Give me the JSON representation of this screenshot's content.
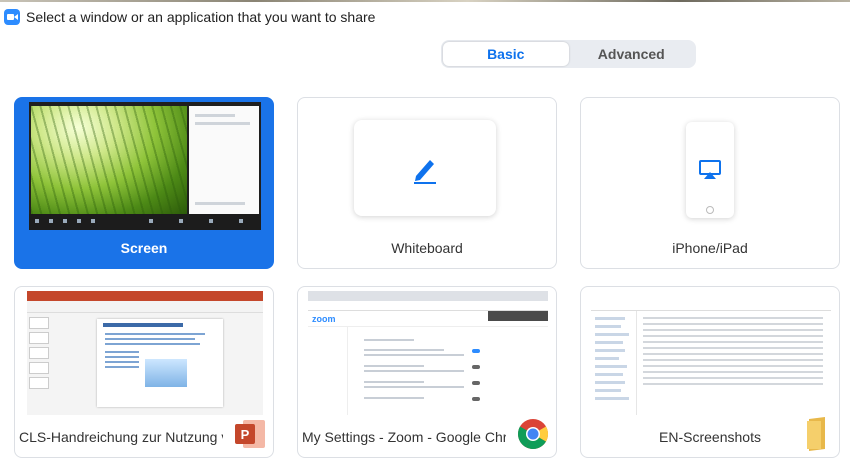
{
  "window": {
    "title": "Select a window or an application that you want to share"
  },
  "tabs": [
    {
      "label": "Basic",
      "active": true
    },
    {
      "label": "Advanced",
      "active": false
    }
  ],
  "tiles": [
    {
      "label": "Screen",
      "selected": true
    },
    {
      "label": "Whiteboard",
      "icon": "pen-icon"
    },
    {
      "label": "iPhone/iPad",
      "icon": "airplay-icon"
    },
    {
      "label": "CLS-Handreichung zur Nutzung v...",
      "app_icon": "powerpoint-icon"
    },
    {
      "label": "My Settings - Zoom - Google Chr...",
      "app_icon": "chrome-icon"
    },
    {
      "label": "EN-Screenshots",
      "app_icon": "folder-icon"
    }
  ],
  "thumbnails": {
    "ppt_slide_title": "Freigaben von Bildschirminhalten"
  },
  "colors": {
    "accent": "#1a73e8",
    "zoom_blue": "#2d8cff",
    "powerpoint": "#c4472b"
  }
}
